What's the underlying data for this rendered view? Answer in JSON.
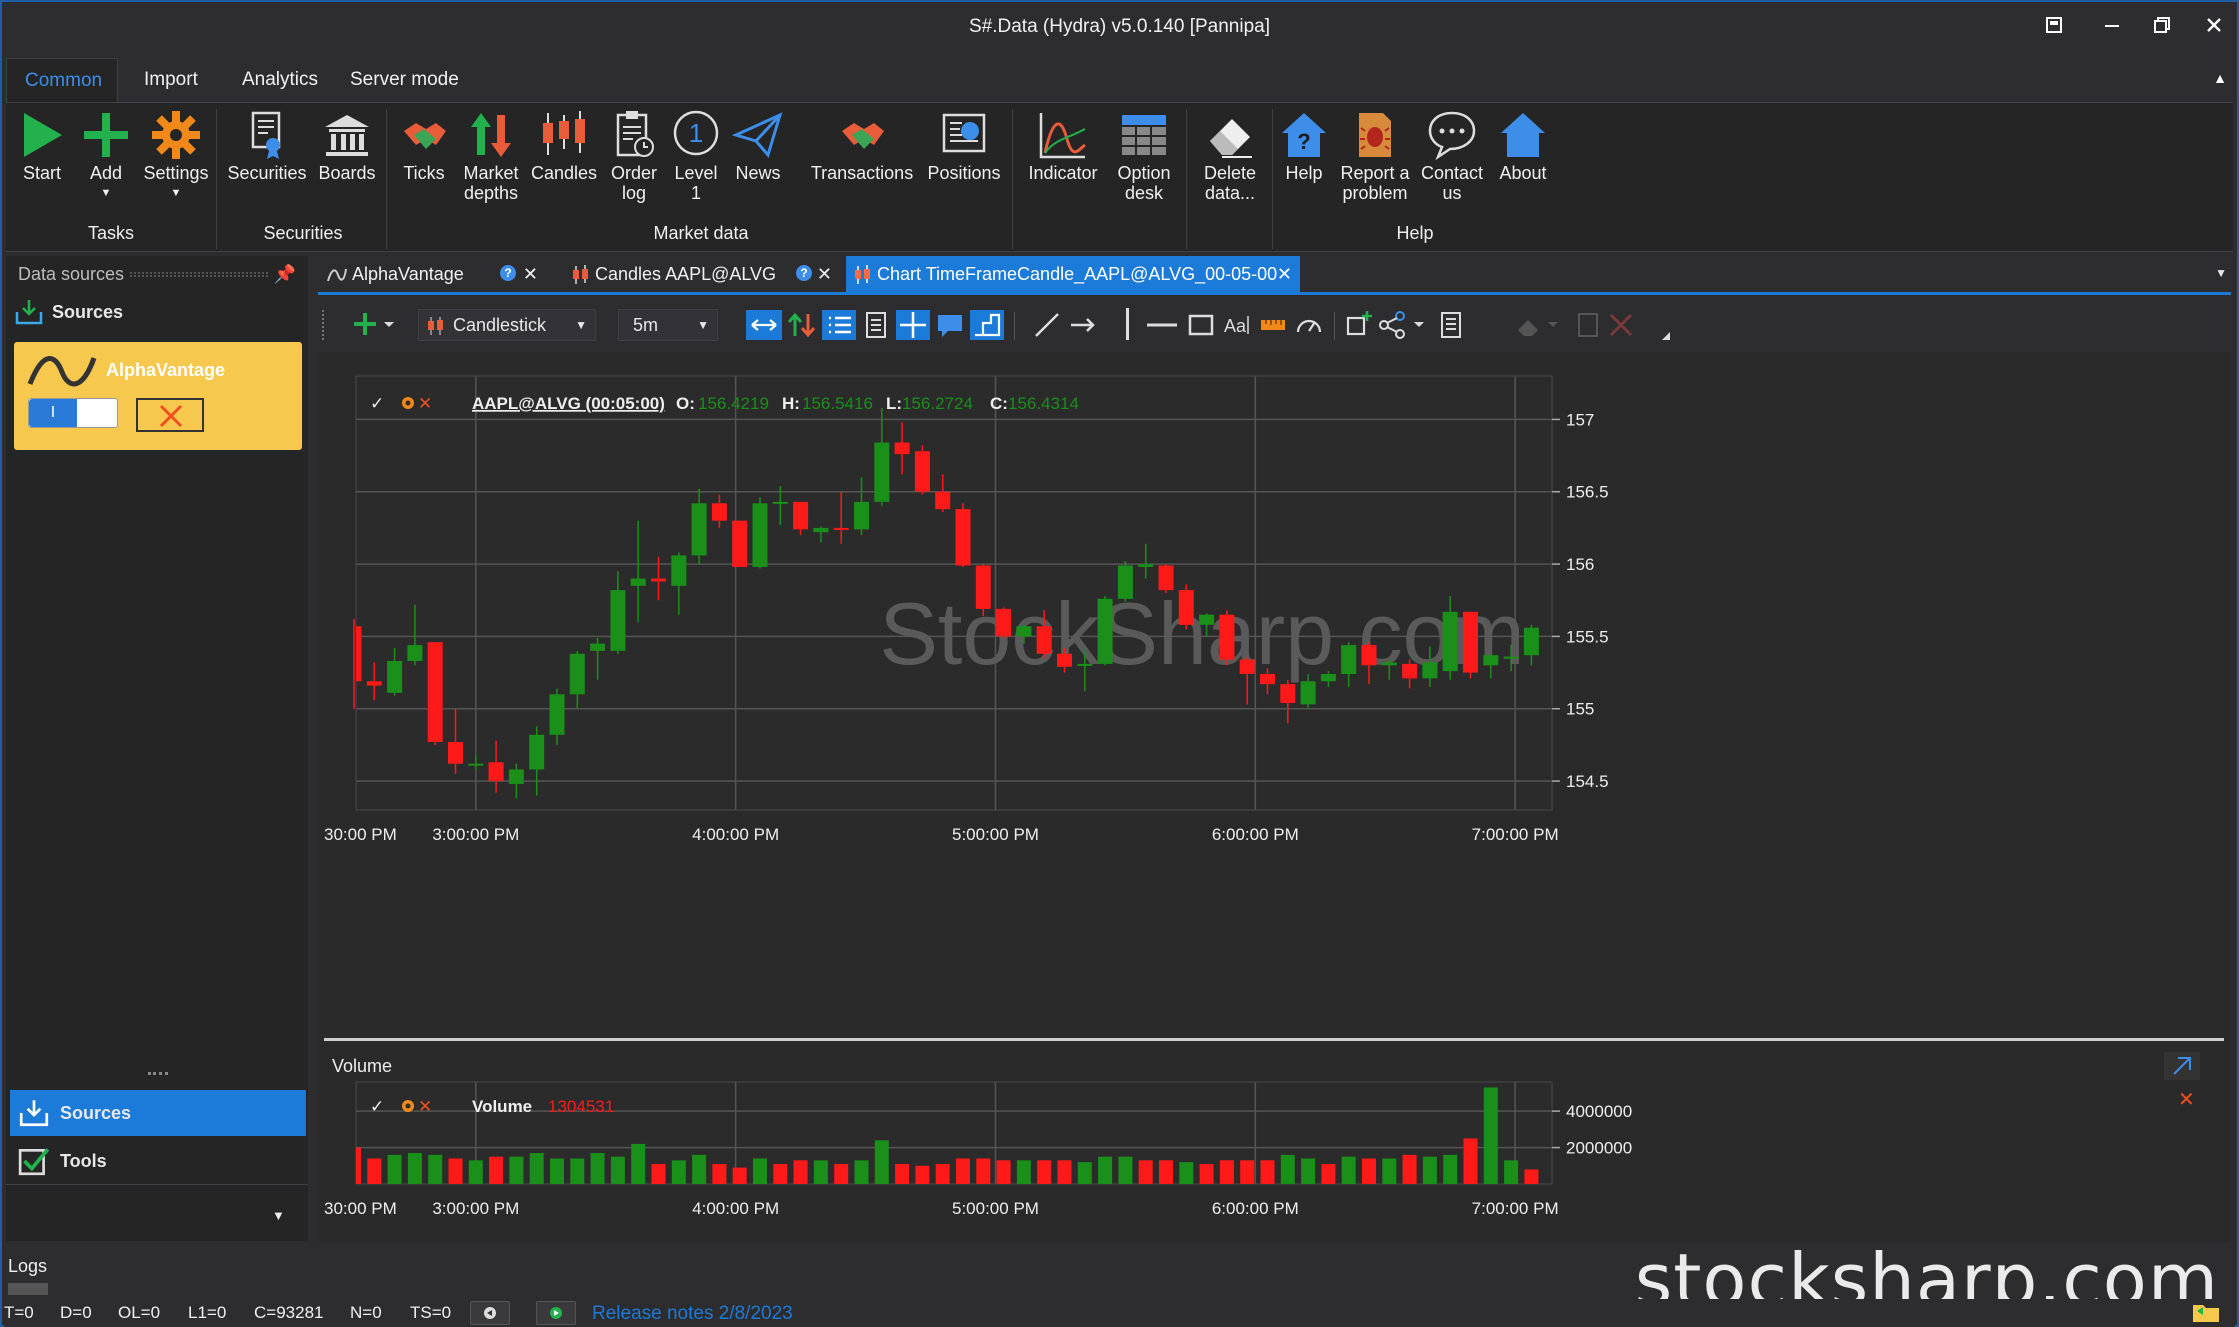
{
  "window": {
    "title": "S#.Data (Hydra) v5.0.140 [Pannipa]"
  },
  "ribbon": {
    "tabs": [
      "Common",
      "Import",
      "Analytics",
      "Server mode"
    ],
    "buttons": {
      "start": "Start",
      "add": "Add",
      "settings": "Settings",
      "securities": "Securities",
      "boards": "Boards",
      "ticks": "Ticks",
      "market_depths_1": "Market",
      "market_depths_2": "depths",
      "candles": "Candles",
      "order_log_1": "Order",
      "order_log_2": "log",
      "level1_1": "Level",
      "level1_2": "1",
      "news": "News",
      "transactions": "Transactions",
      "positions": "Positions",
      "indicator": "Indicator",
      "option_desk_1": "Option",
      "option_desk_2": "desk",
      "delete_data_1": "Delete",
      "delete_data_2": "data...",
      "help": "Help",
      "report_1": "Report a",
      "report_2": "problem",
      "contact_1": "Contact",
      "contact_2": "us",
      "about": "About"
    },
    "groups": {
      "tasks": "Tasks",
      "securities": "Securities",
      "market_data": "Market data",
      "help": "Help"
    }
  },
  "left_panel": {
    "header": "Data sources",
    "sources_title": "Sources",
    "source_name": "AlphaVantage",
    "toggle_label": "I",
    "nav": [
      "Sources",
      "Tools"
    ]
  },
  "doc_tabs": [
    {
      "label": "AlphaVantage"
    },
    {
      "label": "Candles AAPL@ALVG"
    },
    {
      "label": "Chart TimeFrameCandle_AAPL@ALVG_00-05-00"
    }
  ],
  "chart_toolbar": {
    "chart_type": "Candlestick",
    "timeframe": "5m"
  },
  "chart": {
    "legend_security": "AAPL@ALVG (00:05:00)",
    "o_label": "O:",
    "o_value": "156.4219",
    "h_label": "H:",
    "h_value": "156.5416",
    "l_label": "L:",
    "l_value": "156.2724",
    "c_label": "C:",
    "c_value": "156.4314",
    "watermark": "StockSharp.com",
    "volume_pane_title": "Volume",
    "volume_legend": "Volume",
    "volume_value": "1304531",
    "colors": {
      "up": "#1a8f1a",
      "down": "#ff1a1a",
      "grid": "#555555",
      "bg": "#2b2b2b"
    }
  },
  "chart_data": [
    {
      "type": "candlestick",
      "x_ticks": [
        "30:00 PM",
        "3:00:00 PM",
        "4:00:00 PM",
        "5:00:00 PM",
        "6:00:00 PM",
        "7:00:00 PM"
      ],
      "y_ticks": [
        157,
        156.5,
        156,
        155.5,
        155,
        154.5
      ],
      "ylim": [
        154.3,
        157.3
      ],
      "interval_minutes": 5,
      "candles": [
        {
          "o": 155.57,
          "h": 155.62,
          "l": 155.0,
          "c": 155.19
        },
        {
          "o": 155.19,
          "h": 155.32,
          "l": 155.06,
          "c": 155.16
        },
        {
          "o": 155.11,
          "h": 155.42,
          "l": 155.09,
          "c": 155.33
        },
        {
          "o": 155.33,
          "h": 155.72,
          "l": 155.3,
          "c": 155.44
        },
        {
          "o": 155.46,
          "h": 155.46,
          "l": 154.75,
          "c": 154.77
        },
        {
          "o": 154.77,
          "h": 155.0,
          "l": 154.55,
          "c": 154.62
        },
        {
          "o": 154.62,
          "h": 154.68,
          "l": 154.58,
          "c": 154.62
        },
        {
          "o": 154.63,
          "h": 154.78,
          "l": 154.42,
          "c": 154.5
        },
        {
          "o": 154.48,
          "h": 154.62,
          "l": 154.38,
          "c": 154.58
        },
        {
          "o": 154.58,
          "h": 154.88,
          "l": 154.4,
          "c": 154.82
        },
        {
          "o": 154.82,
          "h": 155.14,
          "l": 154.75,
          "c": 155.1
        },
        {
          "o": 155.1,
          "h": 155.4,
          "l": 155.0,
          "c": 155.38
        },
        {
          "o": 155.4,
          "h": 155.49,
          "l": 155.2,
          "c": 155.45
        },
        {
          "o": 155.4,
          "h": 155.95,
          "l": 155.38,
          "c": 155.82
        },
        {
          "o": 155.85,
          "h": 156.3,
          "l": 155.6,
          "c": 155.9
        },
        {
          "o": 155.9,
          "h": 156.05,
          "l": 155.75,
          "c": 155.88
        },
        {
          "o": 155.85,
          "h": 156.08,
          "l": 155.65,
          "c": 156.06
        },
        {
          "o": 156.06,
          "h": 156.52,
          "l": 156.0,
          "c": 156.42
        },
        {
          "o": 156.42,
          "h": 156.48,
          "l": 156.25,
          "c": 156.3
        },
        {
          "o": 156.3,
          "h": 156.3,
          "l": 155.98,
          "c": 155.98
        },
        {
          "o": 155.98,
          "h": 156.46,
          "l": 155.97,
          "c": 156.42
        },
        {
          "o": 156.42,
          "h": 156.54,
          "l": 156.27,
          "c": 156.43
        },
        {
          "o": 156.43,
          "h": 156.43,
          "l": 156.2,
          "c": 156.24
        },
        {
          "o": 156.22,
          "h": 156.26,
          "l": 156.15,
          "c": 156.25
        },
        {
          "o": 156.25,
          "h": 156.5,
          "l": 156.14,
          "c": 156.24
        },
        {
          "o": 156.24,
          "h": 156.6,
          "l": 156.2,
          "c": 156.43
        },
        {
          "o": 156.43,
          "h": 157.08,
          "l": 156.4,
          "c": 156.84
        },
        {
          "o": 156.84,
          "h": 156.98,
          "l": 156.62,
          "c": 156.76
        },
        {
          "o": 156.78,
          "h": 156.82,
          "l": 156.48,
          "c": 156.5
        },
        {
          "o": 156.5,
          "h": 156.62,
          "l": 156.36,
          "c": 156.38
        },
        {
          "o": 156.38,
          "h": 156.42,
          "l": 155.98,
          "c": 155.99
        },
        {
          "o": 155.99,
          "h": 156.0,
          "l": 155.64,
          "c": 155.69
        },
        {
          "o": 155.69,
          "h": 155.7,
          "l": 155.48,
          "c": 155.5
        },
        {
          "o": 155.5,
          "h": 155.58,
          "l": 155.45,
          "c": 155.57
        },
        {
          "o": 155.57,
          "h": 155.68,
          "l": 155.35,
          "c": 155.38
        },
        {
          "o": 155.38,
          "h": 155.42,
          "l": 155.25,
          "c": 155.29
        },
        {
          "o": 155.3,
          "h": 155.4,
          "l": 155.12,
          "c": 155.31
        },
        {
          "o": 155.31,
          "h": 155.78,
          "l": 155.3,
          "c": 155.76
        },
        {
          "o": 155.76,
          "h": 156.02,
          "l": 155.74,
          "c": 155.99
        },
        {
          "o": 155.98,
          "h": 156.14,
          "l": 155.9,
          "c": 156.0
        },
        {
          "o": 155.99,
          "h": 156.0,
          "l": 155.8,
          "c": 155.82
        },
        {
          "o": 155.82,
          "h": 155.86,
          "l": 155.55,
          "c": 155.58
        },
        {
          "o": 155.58,
          "h": 155.66,
          "l": 155.5,
          "c": 155.65
        },
        {
          "o": 155.65,
          "h": 155.68,
          "l": 155.3,
          "c": 155.34
        },
        {
          "o": 155.34,
          "h": 155.36,
          "l": 155.03,
          "c": 155.24
        },
        {
          "o": 155.24,
          "h": 155.28,
          "l": 155.1,
          "c": 155.17
        },
        {
          "o": 155.17,
          "h": 155.2,
          "l": 154.9,
          "c": 155.04
        },
        {
          "o": 155.03,
          "h": 155.24,
          "l": 155.0,
          "c": 155.19
        },
        {
          "o": 155.19,
          "h": 155.26,
          "l": 155.15,
          "c": 155.24
        },
        {
          "o": 155.24,
          "h": 155.46,
          "l": 155.15,
          "c": 155.44
        },
        {
          "o": 155.44,
          "h": 155.46,
          "l": 155.17,
          "c": 155.3
        },
        {
          "o": 155.3,
          "h": 155.34,
          "l": 155.2,
          "c": 155.32
        },
        {
          "o": 155.31,
          "h": 155.34,
          "l": 155.14,
          "c": 155.21
        },
        {
          "o": 155.21,
          "h": 155.43,
          "l": 155.15,
          "c": 155.32
        },
        {
          "o": 155.26,
          "h": 155.78,
          "l": 155.2,
          "c": 155.67
        },
        {
          "o": 155.67,
          "h": 155.67,
          "l": 155.21,
          "c": 155.25
        },
        {
          "o": 155.3,
          "h": 155.38,
          "l": 155.21,
          "c": 155.37
        },
        {
          "o": 155.35,
          "h": 155.44,
          "l": 155.26,
          "c": 155.36
        },
        {
          "o": 155.37,
          "h": 155.58,
          "l": 155.3,
          "c": 155.56
        }
      ]
    },
    {
      "type": "bar",
      "series": [
        {
          "name": "Volume"
        }
      ],
      "y_ticks": [
        4000000,
        2000000
      ],
      "ylim": [
        0,
        5600000
      ],
      "values": [
        2000000,
        1400000,
        1600000,
        1700000,
        1600000,
        1400000,
        1300000,
        1500000,
        1500000,
        1700000,
        1400000,
        1400000,
        1700000,
        1500000,
        2200000,
        1100000,
        1300000,
        1600000,
        1100000,
        900000,
        1400000,
        1100000,
        1300000,
        1300000,
        1100000,
        1300000,
        2400000,
        1100000,
        1000000,
        1100000,
        1400000,
        1400000,
        1300000,
        1300000,
        1300000,
        1300000,
        1200000,
        1500000,
        1500000,
        1300000,
        1300000,
        1200000,
        1100000,
        1300000,
        1300000,
        1300000,
        1600000,
        1400000,
        1100000,
        1500000,
        1400000,
        1400000,
        1600000,
        1500000,
        1600000,
        2500000,
        5300000,
        1300000,
        800000
      ],
      "up": [
        false,
        false,
        true,
        true,
        true,
        false,
        true,
        false,
        true,
        true,
        true,
        true,
        true,
        true,
        true,
        false,
        true,
        true,
        false,
        false,
        true,
        false,
        false,
        true,
        false,
        true,
        true,
        false,
        false,
        false,
        false,
        false,
        false,
        true,
        false,
        false,
        true,
        true,
        true,
        false,
        false,
        true,
        false,
        false,
        false,
        false,
        true,
        true,
        false,
        true,
        false,
        true,
        false,
        true,
        true,
        false,
        true,
        true,
        false
      ]
    }
  ],
  "status": {
    "logs_label": "Logs",
    "t": "T=0",
    "d": "D=0",
    "ol": "OL=0",
    "l1": "L1=0",
    "c": "C=93281",
    "n": "N=0",
    "ts": "TS=0",
    "release_notes": "Release notes 2/8/2023",
    "watermark": "stocksharp.com"
  }
}
